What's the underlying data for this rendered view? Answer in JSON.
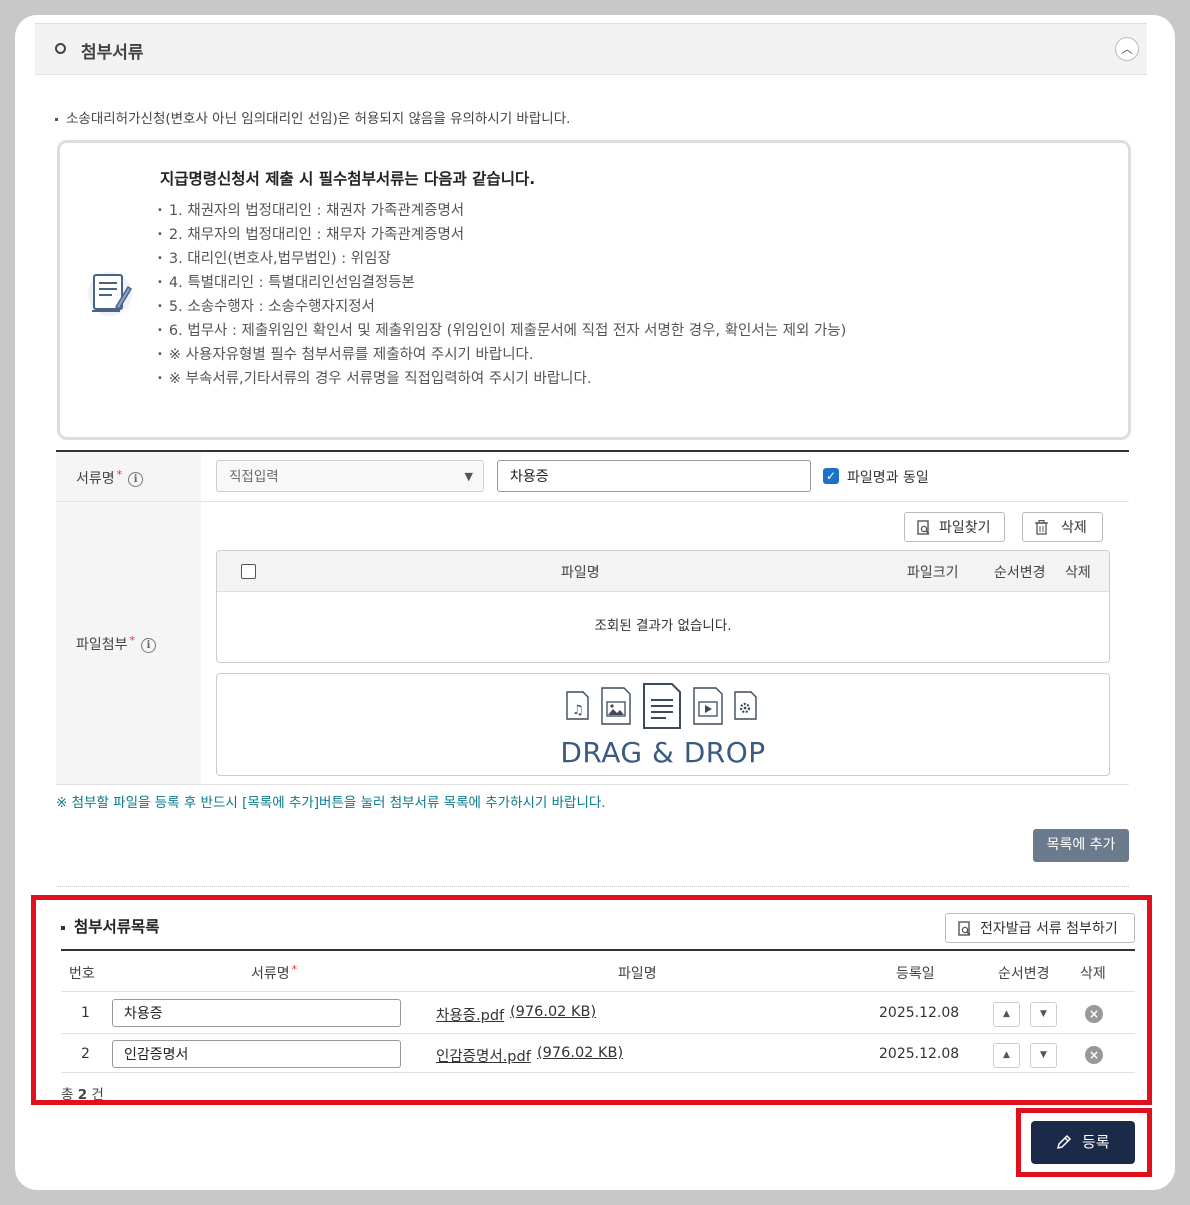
{
  "section": {
    "title": "첨부서류"
  },
  "note": "소송대리허가신청(변호사 아닌 임의대리인 선임)은 허용되지 않음을 유의하시기 바랍니다.",
  "info": {
    "title": "지급명령신청서 제출 시 필수첨부서류는 다음과 같습니다.",
    "items": [
      "1. 채권자의 법정대리인 : 채권자 가족관계증명서",
      "2. 채무자의 법정대리인 : 채무자 가족관계증명서",
      "3. 대리인(변호사,법무법인) : 위임장",
      "4. 특별대리인 : 특별대리인선임결정등본",
      "5. 소송수행자 : 소송수행자지정서",
      "6. 법무사 : 제출위임인 확인서 및 제출위임장 (위임인이 제출문서에 직접 전자 서명한 경우, 확인서는 제외 가능)",
      "※ 사용자유형별 필수 첨부서류를 제출하여 주시기 바랍니다.",
      "※ 부속서류,기타서류의 경우 서류명을 직접입력하여 주시기 바랍니다."
    ]
  },
  "form": {
    "doc_name_label": "서류명",
    "doc_select": "직접입력",
    "doc_input": "차용증",
    "same_as_filename": "파일명과 동일",
    "attach_label": "파일첨부",
    "find_file": "파일찾기",
    "delete": "삭제",
    "file_table": {
      "col_name": "파일명",
      "col_size": "파일크기",
      "col_order": "순서변경",
      "col_delete": "삭제",
      "empty": "조회된 결과가 없습니다."
    },
    "dnd_text": "DRAG & DROP",
    "warning": "※ 첨부할 파일을 등록 후 반드시 [목록에 추가]버튼을 눌러 첨부서류 목록에 추가하시기 바랍니다.",
    "add_to_list": "목록에 추가"
  },
  "list": {
    "title": "첨부서류목록",
    "e_issue_button": "전자발급 서류 첨부하기",
    "headers": {
      "no": "번호",
      "doc_name": "서류명",
      "file_name": "파일명",
      "date": "등록일",
      "order": "순서변경",
      "delete": "삭제"
    },
    "rows": [
      {
        "no": "1",
        "doc_name": "차용증",
        "file": "차용증.pdf",
        "size": "(976.02 KB)",
        "date": "2025.12.08"
      },
      {
        "no": "2",
        "doc_name": "인감증명서",
        "file": "인감증명서.pdf",
        "size": "(976.02 KB)",
        "date": "2025.12.08"
      }
    ],
    "total_prefix": "총",
    "total_count": "2",
    "total_suffix": "건"
  },
  "register_button": "등록",
  "colors": {
    "accent_blue": "#1a73c8",
    "teal_notice": "#0a7a8a",
    "highlight_red": "#e0111d",
    "register_navy": "#1c2a4a",
    "add_gray": "#6b7a8c"
  }
}
